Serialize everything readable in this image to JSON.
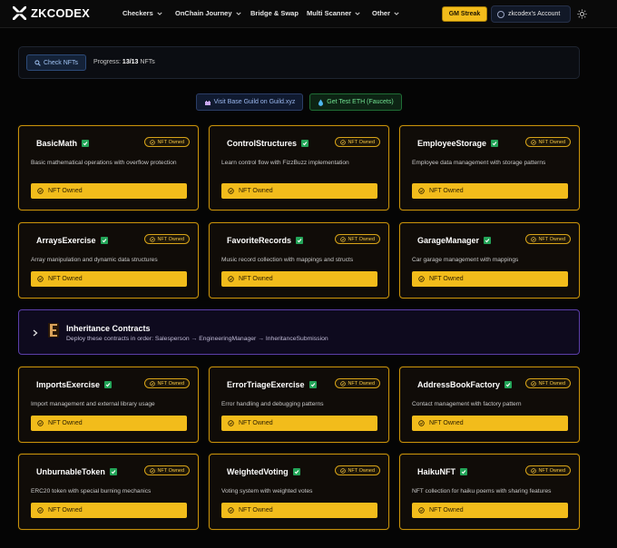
{
  "nav": {
    "logo_text": "ZKCODEX",
    "items": [
      {
        "label": "Checkers"
      },
      {
        "label": "OnChain Journey"
      },
      {
        "label": "Bridge & Swap"
      },
      {
        "label": "Multi Scanner"
      },
      {
        "label": "Other"
      }
    ],
    "streak_label": "GM Streak",
    "account_label": "zkcodex's Account",
    "theme_icon": "sun-icon"
  },
  "progress": {
    "check_label": "Check NFTs",
    "label": "Progress:",
    "value": "13/13",
    "unit": "NFTs"
  },
  "links": {
    "guild_label": "Visit Base Guild on Guild.xyz",
    "faucet_label": "Get Test ETH (Faucets)"
  },
  "badge_label": "NFT Owned",
  "button_label": "NFT Owned",
  "cards": [
    {
      "title": "BasicMath",
      "desc": "Basic mathematical operations with overflow protection"
    },
    {
      "title": "ControlStructures",
      "desc": "Learn control flow with FizzBuzz implementation"
    },
    {
      "title": "EmployeeStorage",
      "desc": "Employee data management with storage patterns"
    },
    {
      "title": "ArraysExercise",
      "desc": "Array manipulation and dynamic data structures"
    },
    {
      "title": "FavoriteRecords",
      "desc": "Music record collection with mappings and structs"
    },
    {
      "title": "GarageManager",
      "desc": "Car garage management with mappings"
    },
    {
      "title": "ImportsExercise",
      "desc": "Import management and external library usage"
    },
    {
      "title": "ErrorTriageExercise",
      "desc": "Error handling and debugging patterns"
    },
    {
      "title": "AddressBookFactory",
      "desc": "Contact management with factory pattern"
    },
    {
      "title": "UnburnableToken",
      "desc": "ERC20 token with special burning mechanics"
    },
    {
      "title": "WeightedVoting",
      "desc": "Voting system with weighted votes"
    },
    {
      "title": "HaikuNFT",
      "desc": "NFT collection for haiku poems with sharing features"
    }
  ],
  "inheritance": {
    "title": "Inheritance Contracts",
    "desc": "Deploy these contracts in order: Salesperson → EngineeringManager → InheritanceSubmission"
  },
  "colors": {
    "accent": "#f2bc1b",
    "background": "#050505",
    "inherit_border": "#5b3ea8",
    "owned_green": "#23a458"
  }
}
